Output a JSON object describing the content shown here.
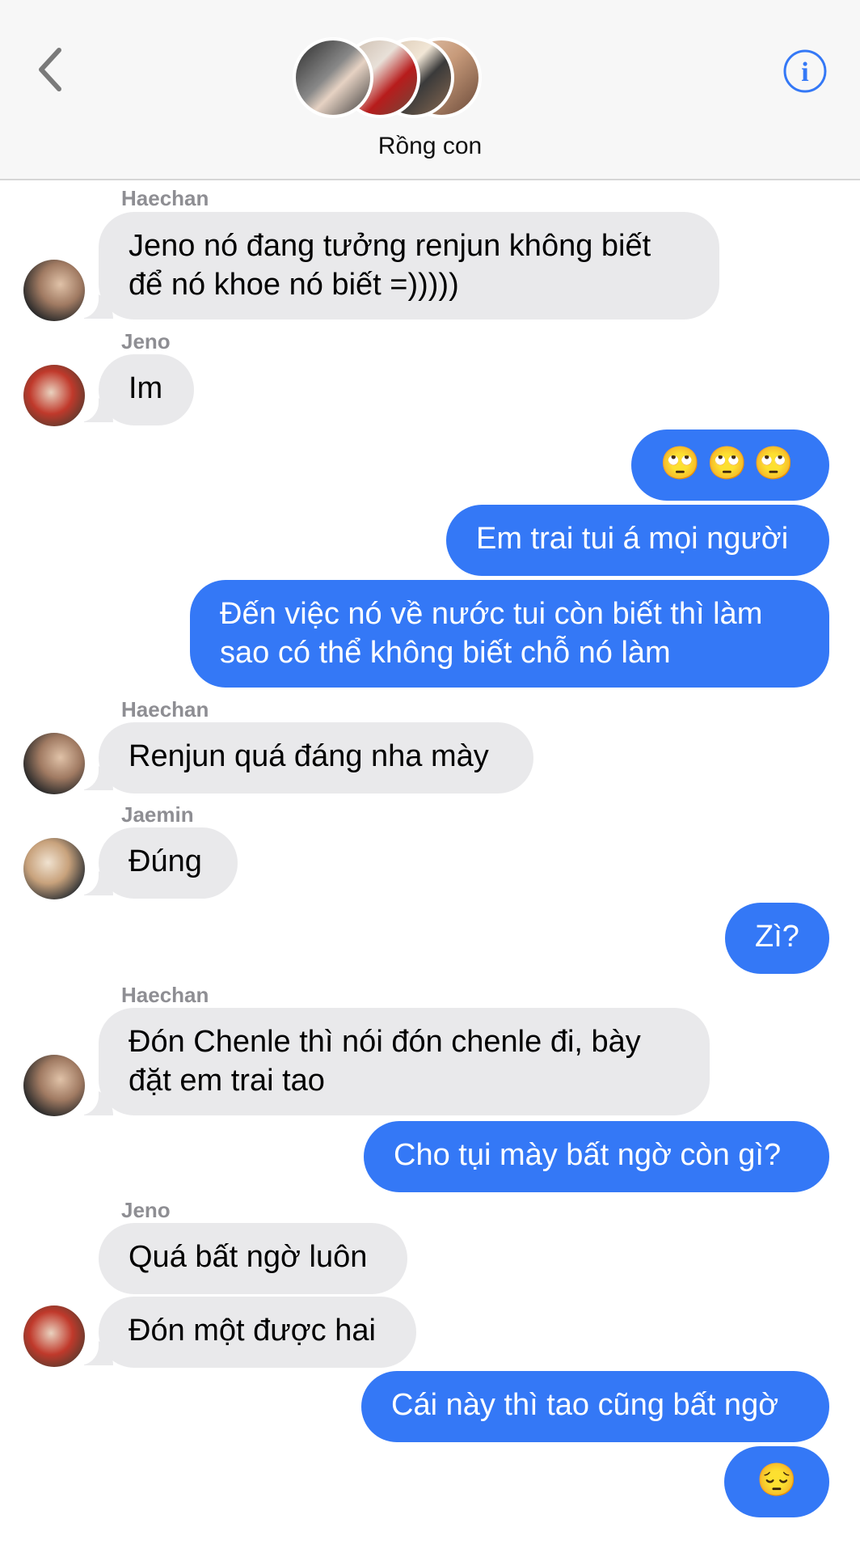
{
  "header": {
    "group_name": "Rồng con",
    "back_icon": "chevron-left-icon",
    "info_icon": "info-icon",
    "info_glyph": "i",
    "accent": "#3478f6"
  },
  "messages": [
    {
      "sender": "Haechan",
      "text": "Jeno nó đang tưởng renjun không biết\nđể nó khoe nó biết =)))))"
    },
    {
      "sender": "Jeno",
      "text": "Im"
    },
    {
      "sender": "me",
      "text": "🙄🙄🙄"
    },
    {
      "sender": "me",
      "text": "Em trai tui á mọi người"
    },
    {
      "sender": "me",
      "text": "Đến việc nó về nước tui còn biết thì làm\nsao có thể không biết chỗ nó làm"
    },
    {
      "sender": "Haechan",
      "text": "Renjun quá đáng nha mày"
    },
    {
      "sender": "Jaemin",
      "text": "Đúng"
    },
    {
      "sender": "me",
      "text": "Zì?"
    },
    {
      "sender": "Haechan",
      "text": "Đón Chenle thì nói đón chenle đi, bày\nđặt em trai tao"
    },
    {
      "sender": "me",
      "text": "Cho tụi mày bất ngờ còn gì?"
    },
    {
      "sender": "Jeno",
      "text": "Quá bất ngờ luôn"
    },
    {
      "sender": "Jeno",
      "text": "Đón một được hai"
    },
    {
      "sender": "me",
      "text": "Cái này thì tao cũng bất ngờ"
    },
    {
      "sender": "me",
      "text": "😔"
    }
  ],
  "colors": {
    "sent_bubble": "#3478f6",
    "received_bubble": "#e9e9eb",
    "sender_label": "#8e8e93"
  }
}
